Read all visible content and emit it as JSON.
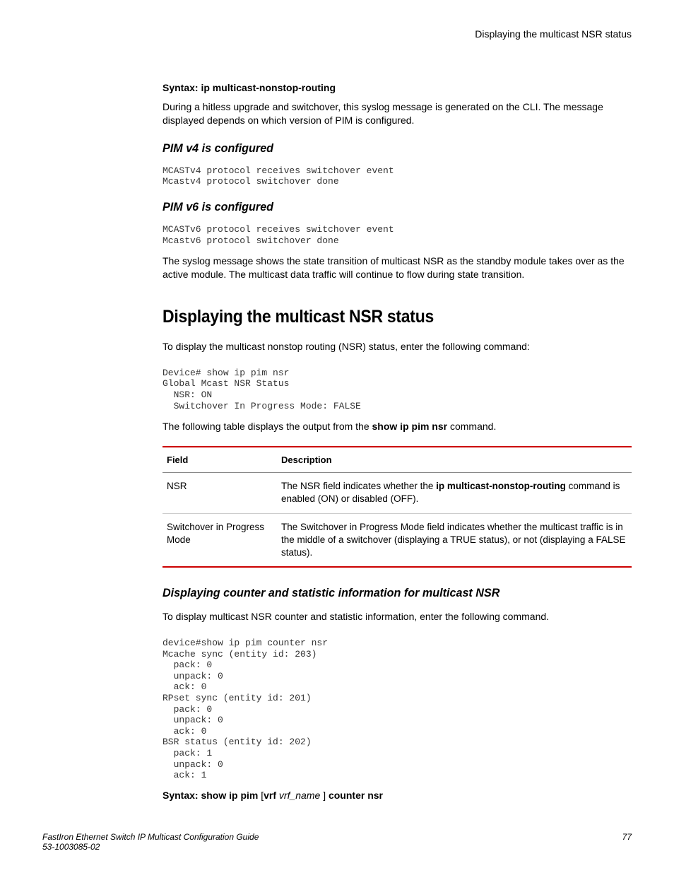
{
  "running_header": "Displaying the multicast NSR status",
  "syntax_top": "Syntax: ip multicast-nonstop-routing",
  "para_intro": "During a hitless upgrade and switchover, this syslog message is generated on the CLI. The message displayed depends on which version of PIM is configured.",
  "sub_v4_title": "PIM v4 is configured",
  "code_v4": "MCASTv4 protocol receives switchover event\nMcastv4 protocol switchover done",
  "sub_v6_title": "PIM v6 is configured",
  "code_v6": "MCASTv6 protocol receives switchover event\nMcastv6 protocol switchover done",
  "para_syslog": "The syslog message shows the state transition of multicast NSR as the standby module takes over as the active module. The multicast data traffic will continue to flow during state transition.",
  "main_heading": "Displaying the multicast NSR status",
  "para_display": "To display the multicast nonstop routing (NSR) status, enter the following command:",
  "code_show_nsr": "Device# show ip pim nsr\nGlobal Mcast NSR Status\n  NSR: ON\n  Switchover In Progress Mode: FALSE",
  "table_intro_pre": "The following table displays the output from the ",
  "table_intro_bold": "show ip pim nsr",
  "table_intro_post": " command.",
  "table_headers": {
    "field": "Field",
    "description": "Description"
  },
  "table_rows": [
    {
      "field": "NSR",
      "desc_pre": "The NSR field indicates whether the ",
      "desc_bold": "ip multicast-nonstop-routing",
      "desc_post": " command is enabled (ON) or disabled (OFF)."
    },
    {
      "field": "Switchover in Progress Mode",
      "desc_pre": "The Switchover in Progress Mode field indicates whether the multicast traffic is in the middle of a switchover (displaying a TRUE status), or not (displaying a FALSE status).",
      "desc_bold": "",
      "desc_post": ""
    }
  ],
  "sub_counter_title": "Displaying counter and statistic information for multicast NSR",
  "para_counter": "To display multicast NSR counter and statistic information, enter the following command.",
  "code_counter": "device#show ip pim counter nsr\nMcache sync (entity id: 203)\n  pack: 0\n  unpack: 0\n  ack: 0\nRPset sync (entity id: 201)\n  pack: 0\n  unpack: 0\n  ack: 0\nBSR status (entity id: 202)\n  pack: 1\n  unpack: 0\n  ack: 1",
  "syntax_bottom": {
    "b1": "Syntax: show ip pim",
    "plain1": " [",
    "b2": "vrf",
    "ital": " vrf_name ",
    "plain2": "] ",
    "b3": "counter nsr"
  },
  "footer": {
    "title": "FastIron Ethernet Switch IP Multicast Configuration Guide",
    "docnum": "53-1003085-02",
    "page": "77"
  }
}
